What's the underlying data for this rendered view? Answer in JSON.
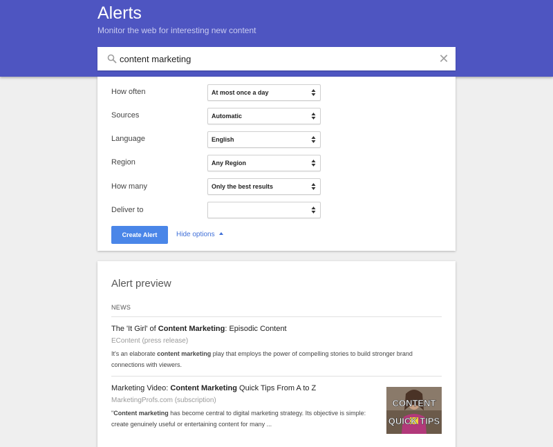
{
  "header": {
    "title": "Alerts",
    "subtitle": "Monitor the web for interesting new content",
    "background_color": "#4e55c1"
  },
  "search": {
    "value": "content marketing",
    "icon": "search-icon",
    "clear_icon": "close-icon"
  },
  "options": {
    "rows": [
      {
        "label": "How often",
        "value": "At most once a day"
      },
      {
        "label": "Sources",
        "value": "Automatic"
      },
      {
        "label": "Language",
        "value": "English"
      },
      {
        "label": "Region",
        "value": "Any Region"
      },
      {
        "label": "How many",
        "value": "Only the best results"
      },
      {
        "label": "Deliver to",
        "value": ""
      }
    ],
    "create_button": "Create Alert",
    "hide_options": "Hide options",
    "accent_color": "#4a86e8"
  },
  "preview": {
    "title": "Alert preview",
    "section_label": "NEWS",
    "items": [
      {
        "title_parts": [
          {
            "text": "The 'It Girl' of ",
            "bold": false
          },
          {
            "text": "Content Marketing",
            "bold": true
          },
          {
            "text": ": Episodic Content",
            "bold": false
          }
        ],
        "source": "EContent (press release)",
        "snippet_parts": [
          {
            "text": "It's an elaborate ",
            "bold": false
          },
          {
            "text": "content marketing",
            "bold": true
          },
          {
            "text": " play that employs the power of compelling stories to build stronger brand connections with viewers.",
            "bold": false
          }
        ]
      },
      {
        "title_parts": [
          {
            "text": "Marketing Video: ",
            "bold": false
          },
          {
            "text": "Content Marketing",
            "bold": true
          },
          {
            "text": " Quick Tips From A to Z",
            "bold": false
          }
        ],
        "source": "MarketingProfs.com (subscription)",
        "snippet_parts": [
          {
            "text": "\"",
            "bold": false
          },
          {
            "text": "Content marketing",
            "bold": true
          },
          {
            "text": " has become central to digital marketing strategy. Its objective is simple: create genuinely useful or entertaining content for many ...",
            "bold": false
          }
        ],
        "thumbnail_text": [
          "CONTENT",
          "QUICK TIPS"
        ]
      }
    ]
  }
}
